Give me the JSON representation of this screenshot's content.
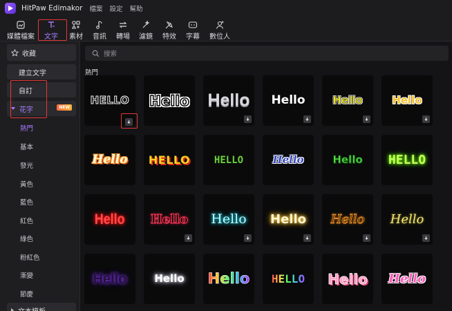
{
  "app": {
    "title": "HitPaw Edimakor"
  },
  "menu": [
    "檔案",
    "設定",
    "幫助"
  ],
  "toolbar": [
    {
      "label": "媒體檔案",
      "icon": "media-icon"
    },
    {
      "label": "文字",
      "icon": "text-icon",
      "active": true
    },
    {
      "label": "素材",
      "icon": "elements-icon"
    },
    {
      "label": "音訊",
      "icon": "audio-icon"
    },
    {
      "label": "轉場",
      "icon": "transition-icon"
    },
    {
      "label": "濾鏡",
      "icon": "filter-icon"
    },
    {
      "label": "特效",
      "icon": "effects-icon"
    },
    {
      "label": "字幕",
      "icon": "subtitle-icon"
    },
    {
      "label": "數位人",
      "icon": "avatar-icon"
    }
  ],
  "sidebar": {
    "favorites": "收藏",
    "create_text": "建立文字",
    "custom": "自訂",
    "fancy_text": "花字",
    "new_badge": "NEW",
    "categories": [
      "熱門",
      "基本",
      "發光",
      "黃色",
      "藍色",
      "紅色",
      "綠色",
      "粉紅色",
      "漸變",
      "節慶"
    ],
    "text_templates": "文本模板"
  },
  "main": {
    "search_placeholder": "搜索",
    "section": "熱門",
    "tiles": [
      "HELLO",
      "Hello",
      "Hello",
      "Hello",
      "Hello",
      "Hello",
      "Hello",
      "HELLO",
      "HELLO",
      "Hello",
      "Hello",
      "HELLO",
      "Hello",
      "Hello",
      "Hello",
      "Hello",
      "Hello",
      "Hello",
      "Hello",
      "Hello",
      "Hello",
      "HELLO",
      "Hello",
      "Hello"
    ]
  },
  "colors": {
    "accent": "#a87bff",
    "highlight": "#e53935",
    "background": "#141416"
  }
}
